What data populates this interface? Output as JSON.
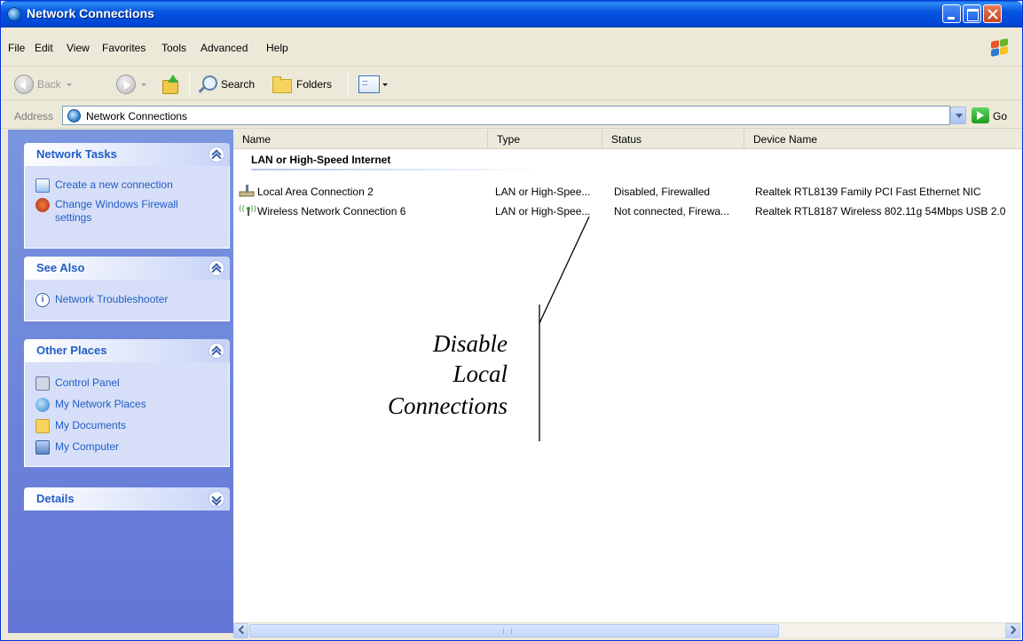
{
  "window": {
    "title": "Network Connections"
  },
  "menu": [
    "File",
    "Edit",
    "View",
    "Favorites",
    "Tools",
    "Advanced",
    "Help"
  ],
  "toolbar": {
    "back": "Back",
    "search": "Search",
    "folders": "Folders"
  },
  "address": {
    "label": "Address",
    "value": "Network Connections",
    "go": "Go"
  },
  "sidebar": {
    "network_tasks": {
      "title": "Network Tasks",
      "items": [
        "Create a new connection",
        "Change Windows Firewall settings"
      ]
    },
    "see_also": {
      "title": "See Also",
      "items": [
        "Network Troubleshooter"
      ]
    },
    "other_places": {
      "title": "Other Places",
      "items": [
        "Control Panel",
        "My Network Places",
        "My Documents",
        "My Computer"
      ]
    },
    "details": {
      "title": "Details"
    }
  },
  "list": {
    "columns": [
      "Name",
      "Type",
      "Status",
      "Device Name"
    ],
    "group": "LAN or High-Speed Internet",
    "rows": [
      {
        "name": "Local Area Connection 2",
        "type": "LAN or High-Spee...",
        "status": "Disabled, Firewalled",
        "device": "Realtek RTL8139 Family PCI Fast Ethernet NIC"
      },
      {
        "name": "Wireless Network Connection 6",
        "type": "LAN or High-Spee...",
        "status": "Not connected, Firewa...",
        "device": "Realtek RTL8187 Wireless 802.11g 54Mbps USB 2.0"
      }
    ]
  },
  "annotation": {
    "line1": "Disable",
    "line2": "Local",
    "line3": "Connections"
  },
  "colors": {
    "title_bar": "#0054e3",
    "task_pane": "#6f85d9",
    "link": "#215dc6"
  }
}
